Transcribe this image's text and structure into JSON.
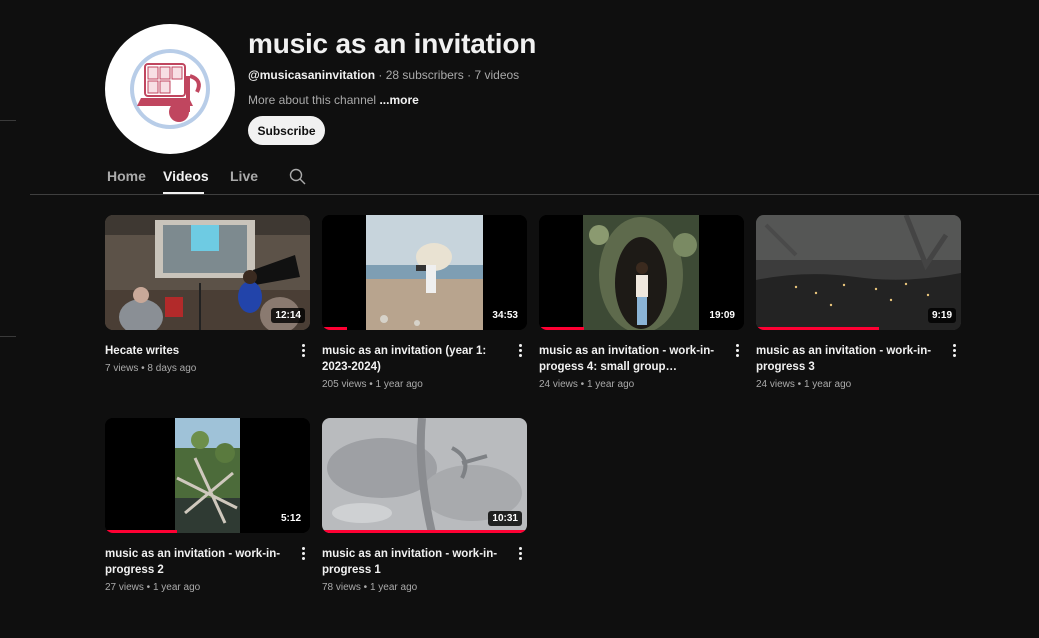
{
  "channel": {
    "name": "music as an invitation",
    "handle": "@musicasaninvitation",
    "subscribers": "28 subscribers",
    "video_count": "7 videos",
    "separator": " · ",
    "about": "More about this channel",
    "about_more": "...more",
    "subscribe_label": "Subscribe",
    "avatar_colors": {
      "ring": "#b8cde8",
      "accent": "#c0465f"
    }
  },
  "tabs": [
    {
      "label": "Home",
      "active": false
    },
    {
      "label": "Videos",
      "active": true
    },
    {
      "label": "Live",
      "active": false
    }
  ],
  "videos": [
    {
      "title": "Hecate writes",
      "views": "7 views",
      "age": "8 days ago",
      "duration": "12:14",
      "watched_pct": 0
    },
    {
      "title": "music as an invitation (year 1: 2023-2024)",
      "views": "205 views",
      "age": "1 year ago",
      "duration": "34:53",
      "watched_pct": 12
    },
    {
      "title": "music as an invitation - work-in-progess 4: small group…",
      "views": "24 views",
      "age": "1 year ago",
      "duration": "19:09",
      "watched_pct": 22
    },
    {
      "title": "music as an invitation - work-in-progress 3",
      "views": "24 views",
      "age": "1 year ago",
      "duration": "9:19",
      "watched_pct": 60
    },
    {
      "title": "music as an invitation - work-in-progress 2",
      "views": "27 views",
      "age": "1 year ago",
      "duration": "5:12",
      "watched_pct": 35
    },
    {
      "title": "music as an invitation - work-in-progress 1",
      "views": "78 views",
      "age": "1 year ago",
      "duration": "10:31",
      "watched_pct": 100
    }
  ],
  "meta_separator": " • "
}
